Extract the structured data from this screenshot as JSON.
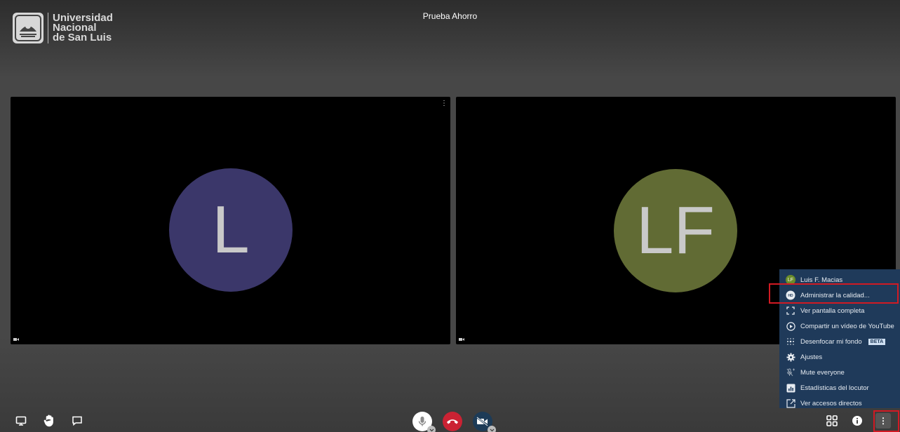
{
  "branding": {
    "line1": "Universidad",
    "line2": "Nacional",
    "line3": "de San Luis"
  },
  "meeting": {
    "title": "Prueba Ahorro"
  },
  "participants": [
    {
      "initials": "L",
      "avatar_color": "#3b376a"
    },
    {
      "initials": "LF",
      "avatar_color": "#616b34"
    }
  ],
  "more_menu": {
    "user": {
      "initials": "LF",
      "name": "Luis F. Macias"
    },
    "items": [
      {
        "label": "Administrar la calidad...",
        "icon": "hd-icon"
      },
      {
        "label": "Ver pantalla completa",
        "icon": "fullscreen-icon"
      },
      {
        "label": "Compartir un vídeo de YouTube",
        "icon": "play-circle-icon"
      },
      {
        "label": "Desenfocar mi fondo",
        "icon": "blur-icon",
        "badge": "BETA"
      },
      {
        "label": "Ajustes",
        "icon": "gear-icon"
      },
      {
        "label": "Mute everyone",
        "icon": "mute-everyone-icon"
      },
      {
        "label": "Estadísticas del locutor",
        "icon": "stats-icon"
      },
      {
        "label": "Ver accesos directos",
        "icon": "shortcut-icon"
      }
    ]
  },
  "colors": {
    "highlight": "#d11a23",
    "menu_bg": "#1f3a5a",
    "hangup": "#cb2233"
  }
}
